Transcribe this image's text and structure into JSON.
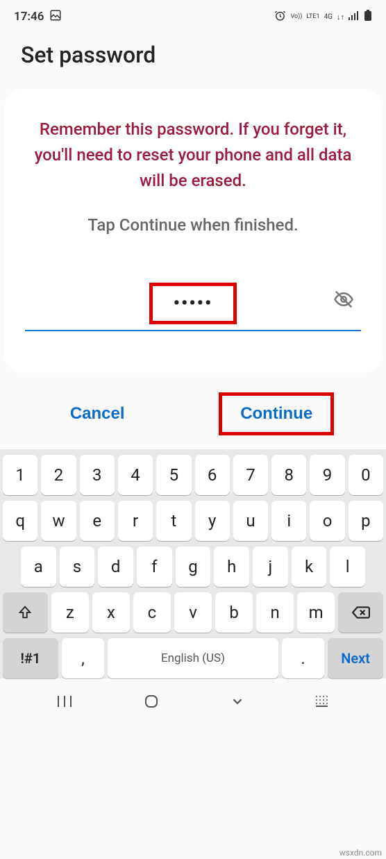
{
  "status": {
    "time": "17:46",
    "network": "LTE1",
    "signal": "4G",
    "vo": "Vo))"
  },
  "page": {
    "title": "Set password",
    "warning": "Remember this password. If you forget it, you'll need to reset your phone and all data will be erased.",
    "instruction": "Tap Continue when finished.",
    "password_masked": "•••••"
  },
  "actions": {
    "cancel": "Cancel",
    "continue": "Continue"
  },
  "keyboard": {
    "row_num": [
      "1",
      "2",
      "3",
      "4",
      "5",
      "6",
      "7",
      "8",
      "9",
      "0"
    ],
    "row_q": [
      "q",
      "w",
      "e",
      "r",
      "t",
      "y",
      "u",
      "i",
      "o",
      "p"
    ],
    "row_a": [
      "a",
      "s",
      "d",
      "f",
      "g",
      "h",
      "j",
      "k",
      "l"
    ],
    "row_z": [
      "z",
      "x",
      "c",
      "v",
      "b",
      "n",
      "m"
    ],
    "sym": "!#1",
    "comma": ",",
    "space": "English (US)",
    "period": ".",
    "next": "Next"
  },
  "watermark": "wsxdn.com"
}
